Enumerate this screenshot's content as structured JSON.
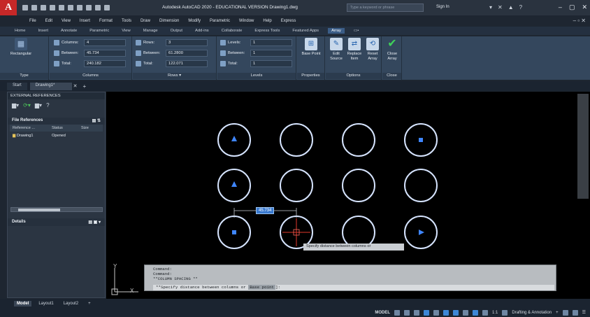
{
  "titlebar": {
    "window_title": "Autodesk AutoCAD 2020 - EDUCATIONAL VERSION    Drawing1.dwg",
    "search_placeholder": "Type a keyword or phrase",
    "sign_in": "Sign In"
  },
  "menubar": [
    "File",
    "Edit",
    "View",
    "Insert",
    "Format",
    "Tools",
    "Draw",
    "Dimension",
    "Modify",
    "Parametric",
    "Window",
    "Help",
    "Express"
  ],
  "ribbon_tabs": [
    "Home",
    "Insert",
    "Annotate",
    "Parametric",
    "View",
    "Manage",
    "Output",
    "Add-ins",
    "Collaborate",
    "Express Tools",
    "Featured Apps",
    "Array"
  ],
  "ribbon_active_tab": "Array",
  "ribbon": {
    "type_panel": {
      "button": "Rectangular",
      "title": "Type"
    },
    "columns_panel": {
      "title": "Columns",
      "fields": [
        {
          "label": "Columns:",
          "value": "4"
        },
        {
          "label": "Between:",
          "value": "45.734"
        },
        {
          "label": "Total:",
          "value": "240.182"
        }
      ]
    },
    "rows_panel": {
      "title": "Rows ▾",
      "fields": [
        {
          "label": "Rows:",
          "value": "3"
        },
        {
          "label": "Between:",
          "value": "61.2800"
        },
        {
          "label": "Total:",
          "value": "122.071"
        }
      ]
    },
    "levels_panel": {
      "title": "Levels",
      "fields": [
        {
          "label": "Levels:",
          "value": "1"
        },
        {
          "label": "Between:",
          "value": "1"
        },
        {
          "label": "Total:",
          "value": "1"
        }
      ]
    },
    "properties_panel": {
      "title": "Properties",
      "buttons": [
        "Base Point"
      ]
    },
    "options_panel": {
      "title": "Options",
      "buttons": [
        "Edit Source",
        "Replace Item",
        "Reset Array"
      ]
    },
    "close_panel": {
      "title": "Close",
      "buttons": [
        "Close Array"
      ]
    }
  },
  "file_tabs": {
    "start": "Start",
    "drawing": "Drawing1*"
  },
  "xref": {
    "title": "EXTERNAL REFERENCES",
    "file_references": "File References",
    "columns": [
      "Reference ...",
      "Status",
      "Size"
    ],
    "row": {
      "name": "Drawing1",
      "status": "Opened",
      "size": ""
    },
    "details": "Details"
  },
  "canvas": {
    "dynamic_input": "45.734",
    "tooltip": "Specify distance between columns or",
    "ucs_x": "X",
    "ucs_y": "Y"
  },
  "command": {
    "history": [
      "Command:",
      "Command:",
      "**COLUMN SPACING **"
    ],
    "prompt": "**Specify distance between columns or ",
    "option": "Base point",
    "suffix": "]:"
  },
  "layout_tabs": [
    "Model",
    "Layout1",
    "Layout2"
  ],
  "statusbar": {
    "model": "MODEL",
    "scale": "1:1",
    "workspace": "Drafting & Annotation"
  },
  "colors": {
    "accent": "#3d86d6",
    "circle": "#d6e4ff",
    "marker": "#3f86ff",
    "crosshair": "#e0382b"
  }
}
